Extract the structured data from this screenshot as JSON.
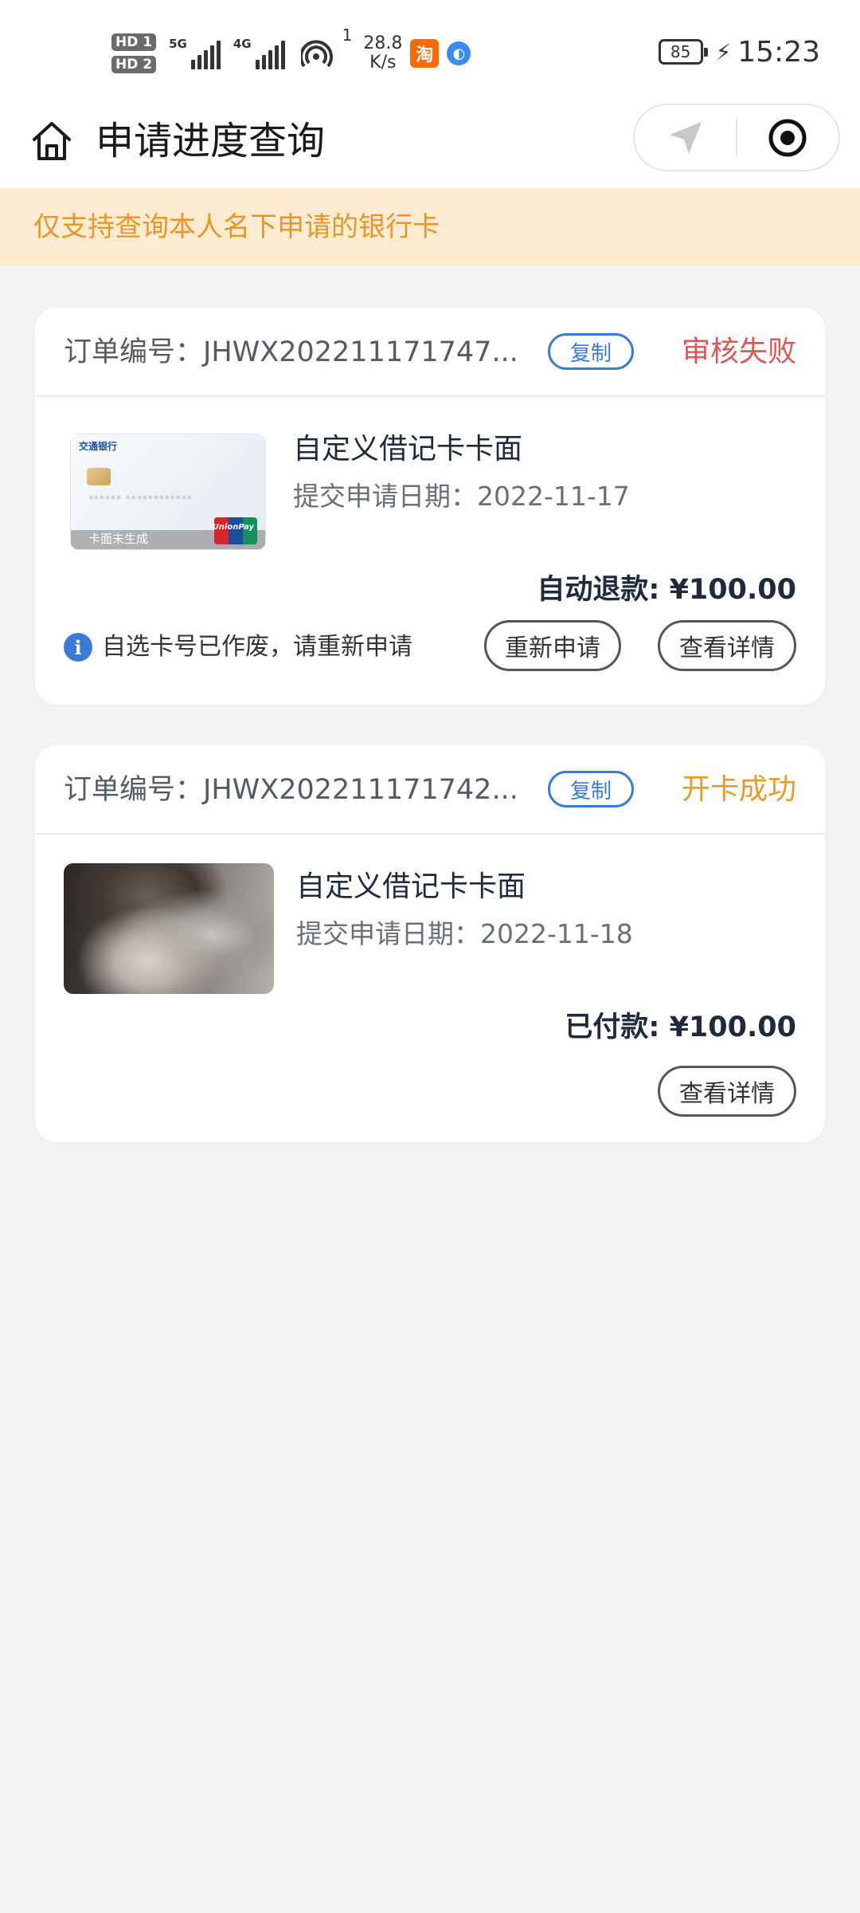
{
  "status_bar": {
    "hd1": "HD 1",
    "hd2": "HD 2",
    "sig1_label": "5G",
    "sig2_label": "4G",
    "hotspot_count": "1",
    "net_speed_value": "28.8",
    "net_speed_unit": "K/s",
    "app_icon_1": "淘",
    "battery": "85",
    "time": "15:23"
  },
  "nav": {
    "title": "申请进度查询"
  },
  "notice": {
    "text": "仅支持查询本人名下申请的银行卡"
  },
  "orders": [
    {
      "order_no": "订单编号：JHWX202211171747...",
      "copy_label": "复制",
      "status": "审核失败",
      "status_color": "#e05555",
      "product": "自定义借记卡卡面",
      "date": "提交申请日期：2022-11-17",
      "amount": "自动退款: ¥100.00",
      "tip": "自选卡号已作废，请重新申请",
      "card_image": {
        "bank_name": "交通银行",
        "card_number_mask": "****** ************",
        "footer_text": "卡面未生成",
        "network_text": "UnionPay"
      },
      "buttons": [
        "重新申请",
        "查看详情"
      ]
    },
    {
      "order_no": "订单编号：JHWX202211171742...",
      "copy_label": "复制",
      "status": "开卡成功",
      "status_color": "#e89a2a",
      "product": "自定义借记卡卡面",
      "date": "提交申请日期：2022-11-18",
      "amount": "已付款: ¥100.00",
      "buttons": [
        "查看详情"
      ]
    }
  ]
}
